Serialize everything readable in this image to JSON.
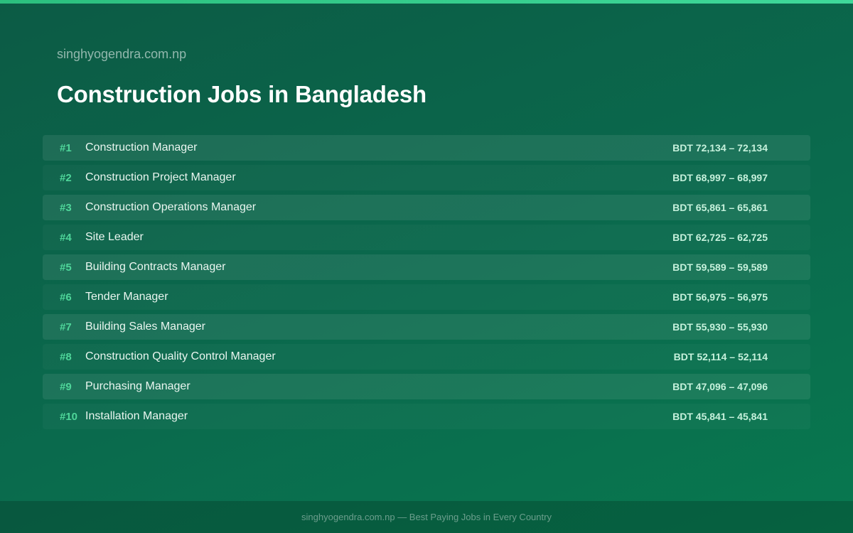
{
  "header": {
    "site_name": "singhyogendra.com.np",
    "title": "Construction Jobs in Bangladesh"
  },
  "jobs": [
    {
      "rank": "#1",
      "title": "Construction Manager",
      "salary": "BDT 72,134 – 72,134"
    },
    {
      "rank": "#2",
      "title": "Construction Project Manager",
      "salary": "BDT 68,997 – 68,997"
    },
    {
      "rank": "#3",
      "title": "Construction Operations Manager",
      "salary": "BDT 65,861 – 65,861"
    },
    {
      "rank": "#4",
      "title": "Site Leader",
      "salary": "BDT 62,725 – 62,725"
    },
    {
      "rank": "#5",
      "title": "Building Contracts Manager",
      "salary": "BDT 59,589 – 59,589"
    },
    {
      "rank": "#6",
      "title": "Tender Manager",
      "salary": "BDT 56,975 – 56,975"
    },
    {
      "rank": "#7",
      "title": "Building Sales Manager",
      "salary": "BDT 55,930 – 55,930"
    },
    {
      "rank": "#8",
      "title": "Construction Quality Control Manager",
      "salary": "BDT 52,114 – 52,114"
    },
    {
      "rank": "#9",
      "title": "Purchasing Manager",
      "salary": "BDT 47,096 – 47,096"
    },
    {
      "rank": "#10",
      "title": "Installation Manager",
      "salary": "BDT 45,841 – 45,841"
    }
  ],
  "footer": {
    "text": "singhyogendra.com.np — Best Paying Jobs in Every Country"
  },
  "colors": {
    "background": "#0a6a4d",
    "accent": "#3fd99a",
    "rank": "#4fd69a"
  }
}
